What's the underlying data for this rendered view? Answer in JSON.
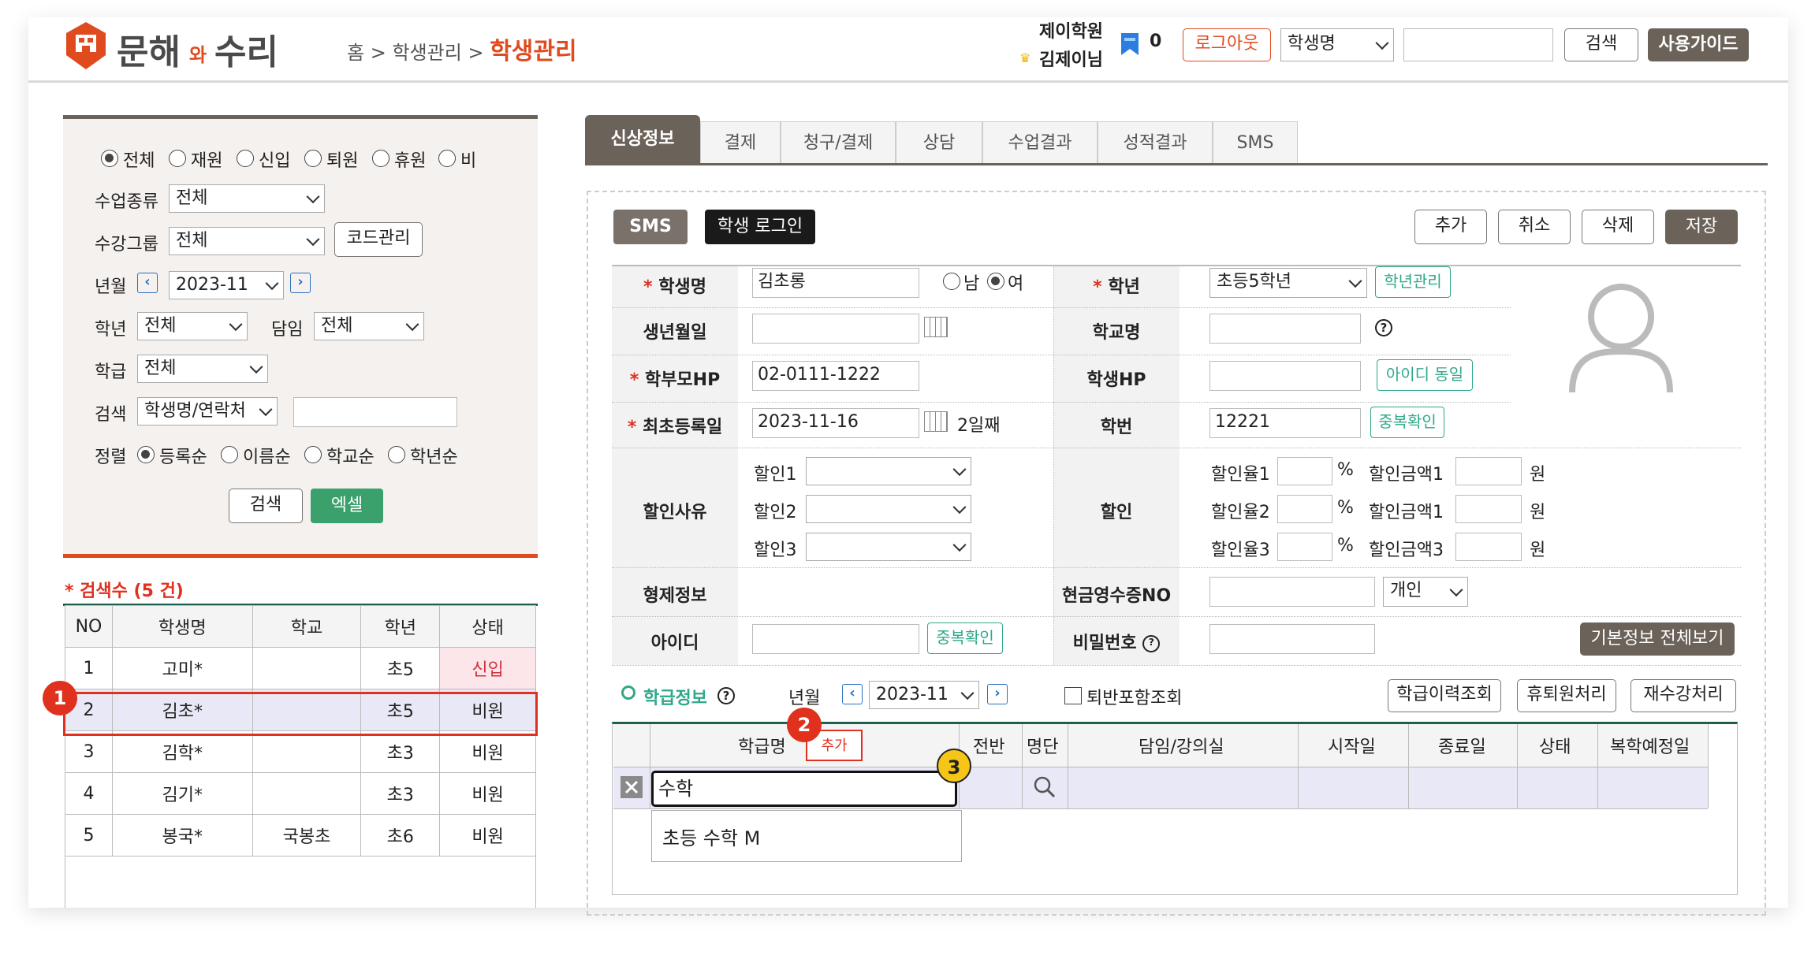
{
  "brand": {
    "name_a": "문해",
    "name_b": "와",
    "name_c": "수리"
  },
  "breadcrumb": {
    "home": "홈",
    "sep1": ">",
    "mid": "학생관리",
    "sep2": ">",
    "current": "학생관리"
  },
  "header": {
    "academy": "제이학원",
    "user": "김제이님",
    "badge_count": "0",
    "logout": "로그아웃",
    "search_select": "학생명",
    "search_value": "",
    "search_btn": "검색",
    "guide_btn": "사용가이드"
  },
  "filter": {
    "status_options": [
      "전체",
      "재원",
      "신입",
      "퇴원",
      "휴원",
      "비"
    ],
    "status_selected": "전체",
    "class_type_label": "수업종류",
    "class_type_value": "전체",
    "group_label": "수강그룹",
    "group_value": "전체",
    "code_btn": "코드관리",
    "ym_label": "년월",
    "ym_value": "2023-11",
    "grade_label": "학년",
    "grade_value": "전체",
    "teacher_label": "담임",
    "teacher_value": "전체",
    "class_label": "학급",
    "class_value": "전체",
    "search_label": "검색",
    "search_field": "학생명/연락처",
    "search_value": "",
    "sort_label": "정렬",
    "sort_options": [
      "등록순",
      "이름순",
      "학교순",
      "학년순"
    ],
    "sort_selected": "등록순",
    "search_btn": "검색",
    "excel_btn": "엑셀"
  },
  "result": {
    "count_text": "* 검색수 (5 건)"
  },
  "student_table": {
    "headers": [
      "NO",
      "학생명",
      "학교",
      "학년",
      "상태"
    ],
    "rows": [
      {
        "no": "1",
        "name": "고미*",
        "school": "",
        "grade": "초5",
        "status": "신입"
      },
      {
        "no": "2",
        "name": "김초*",
        "school": "",
        "grade": "초5",
        "status": "비원"
      },
      {
        "no": "3",
        "name": "김학*",
        "school": "",
        "grade": "초3",
        "status": "비원"
      },
      {
        "no": "4",
        "name": "김기*",
        "school": "",
        "grade": "초3",
        "status": "비원"
      },
      {
        "no": "5",
        "name": "봉국*",
        "school": "국봉초",
        "grade": "초6",
        "status": "비원"
      }
    ]
  },
  "tabs": [
    "신상정보",
    "결제",
    "청구/결제",
    "상담",
    "수업결과",
    "성적결과",
    "SMS"
  ],
  "actions": {
    "sms": "SMS",
    "student_login": "학생 로그인",
    "add": "추가",
    "cancel": "취소",
    "delete": "삭제",
    "save": "저장"
  },
  "form": {
    "name_label": "학생명",
    "name_value": "김초롱",
    "gender_male": "남",
    "gender_female": "여",
    "gender_selected": "여",
    "grade_label": "학년",
    "grade_value": "초등5학년",
    "grade_mgmt": "학년관리",
    "birth_label": "생년월일",
    "birth_value": "",
    "school_label": "학교명",
    "school_value": "",
    "parent_hp_label": "학부모HP",
    "parent_hp_value": "02-0111-1222",
    "student_hp_label": "학생HP",
    "student_hp_value": "",
    "same_id_btn": "아이디 동일",
    "first_reg_label": "최초등록일",
    "first_reg_value": "2023-11-16",
    "first_reg_day": "2일째",
    "student_no_label": "학번",
    "student_no_value": "12221",
    "dup_check_btn": "중복확인",
    "discount_reason_label": "할인사유",
    "discount_items": [
      "할인1",
      "할인2",
      "할인3"
    ],
    "discount_label": "할인",
    "rate_labels": [
      "할인율1",
      "할인율2",
      "할인율3"
    ],
    "percent": "%",
    "amount_labels": [
      "할인금액1",
      "할인금액1",
      "할인금액3"
    ],
    "won": "원",
    "sibling_label": "형제정보",
    "receipt_label": "현금영수증NO",
    "receipt_type": "개인",
    "id_label": "아이디",
    "id_value": "",
    "id_dup_btn": "중복확인",
    "pw_label": "비밀번호",
    "pw_value": "",
    "basic_all_btn": "기본정보 전체보기"
  },
  "class_info": {
    "title": "학급정보",
    "ym_label": "년월",
    "ym_value": "2023-11",
    "include_quit": "퇴반포함조회",
    "history_btn": "학급이력조회",
    "quit_btn": "휴퇴원처리",
    "retake_btn": "재수강처리",
    "headers": [
      "학급명",
      "전반",
      "명단",
      "담임/강의실",
      "시작일",
      "종료일",
      "상태",
      "복학예정일"
    ],
    "add_btn": "추가",
    "input_value": "수학",
    "suggestion": "초등 수학 M"
  },
  "markers": [
    "1",
    "2",
    "3"
  ],
  "colors": {
    "accent_red": "#e04a1f",
    "brand_dark": "#4a4a4a",
    "green": "#2fa88a",
    "tab_active": "#6b6259"
  }
}
